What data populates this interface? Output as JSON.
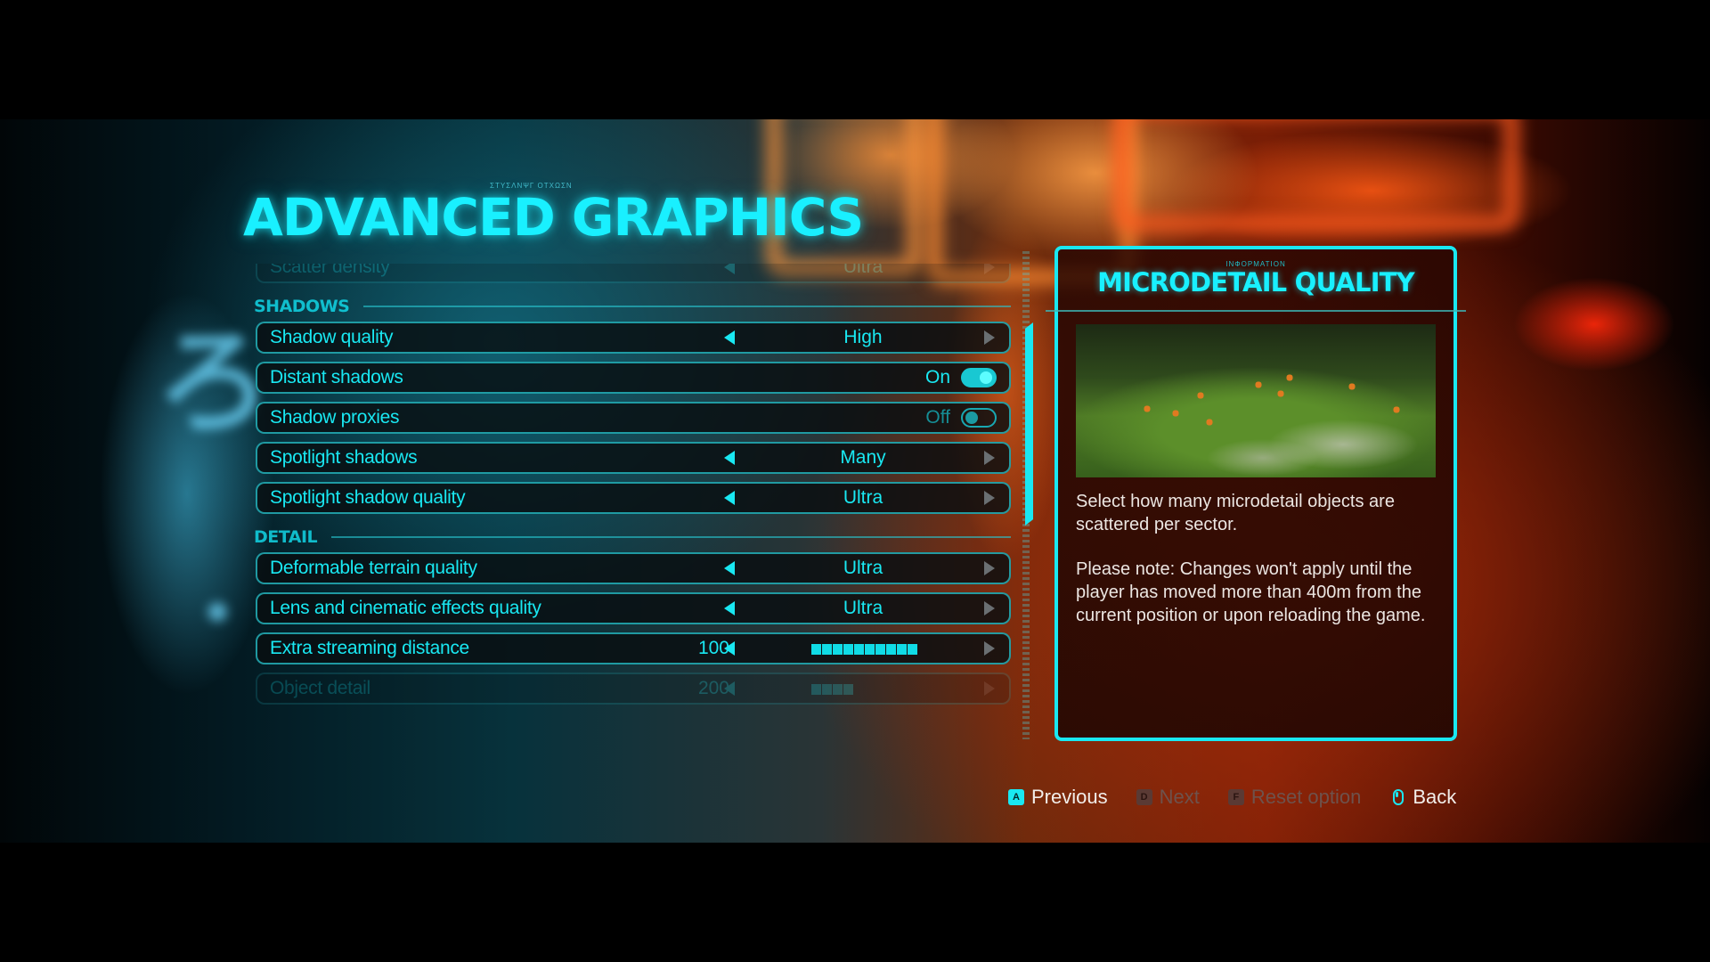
{
  "page": {
    "title_caption": "ΣΤΥΣΛΝΨΓ ΟΤΧΩΣΝ",
    "title": "ADVANCED GRAPHICS"
  },
  "settings": {
    "faded_top_row": {
      "label": "Scatter density",
      "value": "Ultra"
    },
    "sections": [
      {
        "label": "SHADOWS",
        "rows": [
          {
            "label": "Shadow quality",
            "type": "selector",
            "value": "High"
          },
          {
            "label": "Distant shadows",
            "type": "toggle",
            "state_text": "On",
            "on": true
          },
          {
            "label": "Shadow proxies",
            "type": "toggle",
            "state_text": "Off",
            "on": false
          },
          {
            "label": "Spotlight shadows",
            "type": "selector",
            "value": "Many"
          },
          {
            "label": "Spotlight shadow quality",
            "type": "selector",
            "value": "Ultra"
          }
        ]
      },
      {
        "label": "DETAIL",
        "rows": [
          {
            "label": "Deformable terrain quality",
            "type": "selector",
            "value": "Ultra"
          },
          {
            "label": "Lens and cinematic effects quality",
            "type": "selector",
            "value": "Ultra"
          },
          {
            "label": "Extra streaming distance",
            "type": "slider",
            "number": "100",
            "fill_fraction": 1.0
          }
        ]
      }
    ],
    "faded_bottom_row": {
      "label": "Object detail",
      "number": "200",
      "fill_fraction": 0.4
    }
  },
  "info_panel": {
    "caption": "ΙΝΦΟΡΜΑΤΙΟΝ",
    "title": "MICRODETAIL QUALITY",
    "preview_alt": "forest-moss-mushroom-preview",
    "paragraphs": [
      "Select how many microdetail objects are scattered per sector.",
      "Please note: Changes won't apply until the player has moved more than 400m from the current position or upon reloading the game."
    ]
  },
  "footer": {
    "hints": [
      {
        "key": "A",
        "label": "Previous",
        "enabled": true
      },
      {
        "key": "D",
        "label": "Next",
        "enabled": false
      },
      {
        "key": "F",
        "label": "Reset option",
        "enabled": false
      },
      {
        "key": "mouse",
        "label": "Back",
        "enabled": true
      }
    ]
  },
  "colors": {
    "accent": "#19e8f2",
    "panel_text": "#ece6e2",
    "disabled": "#6e524c"
  }
}
